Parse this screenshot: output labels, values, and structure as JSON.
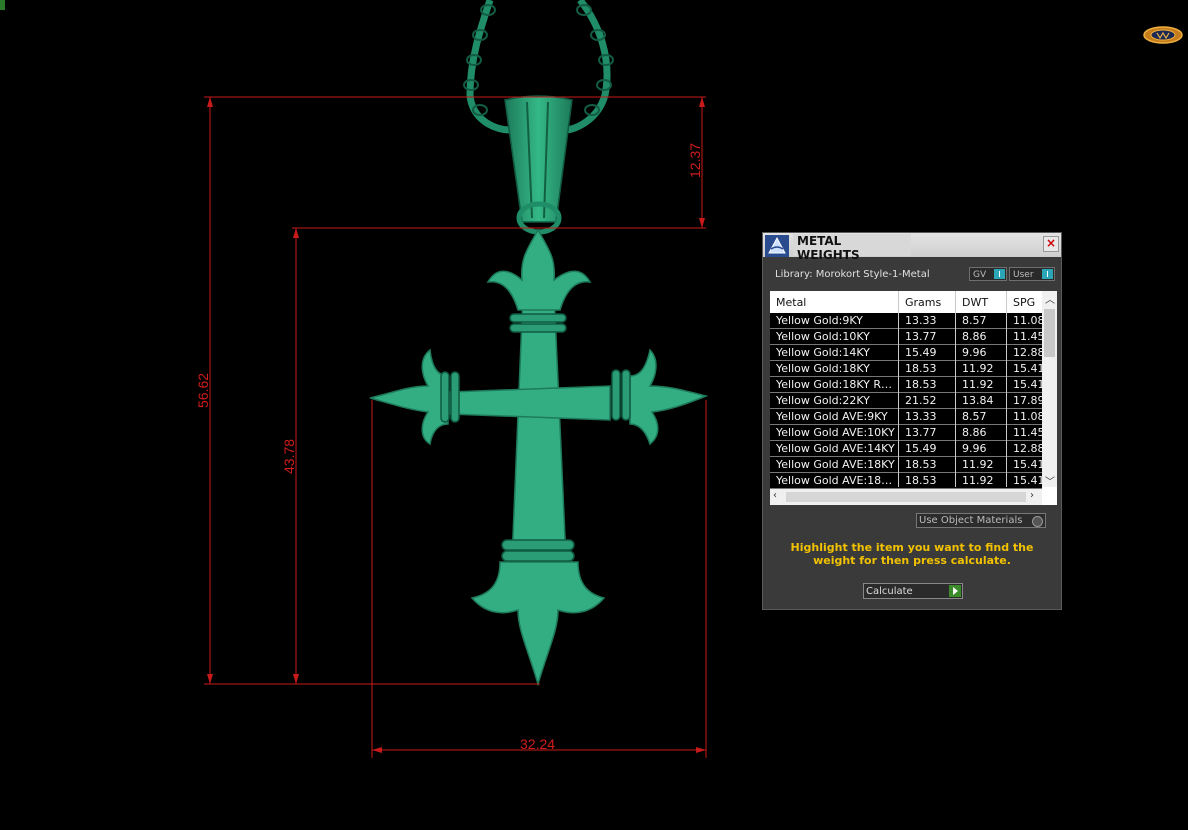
{
  "dimensions": {
    "total_height": "56.62",
    "body_height": "43.78",
    "bail_height": "12.37",
    "width": "32.24"
  },
  "panel": {
    "title": "METAL WEIGHTS",
    "close_label": "×",
    "library": "Library: Morokort Style-1-Metal",
    "toggle_gv": "GV",
    "toggle_user": "User",
    "columns": [
      "Metal",
      "Grams",
      "DWT",
      "SPG"
    ],
    "rows": [
      {
        "metal": "Yellow Gold:9KY",
        "grams": "13.33",
        "dwt": "8.57",
        "spg": "11.08"
      },
      {
        "metal": "Yellow Gold:10KY",
        "grams": "13.77",
        "dwt": "8.86",
        "spg": "11.45"
      },
      {
        "metal": "Yellow Gold:14KY",
        "grams": "15.49",
        "dwt": "9.96",
        "spg": "12.88"
      },
      {
        "metal": "Yellow Gold:18KY",
        "grams": "18.53",
        "dwt": "11.92",
        "spg": "15.41"
      },
      {
        "metal": "Yellow Gold:18KY R…",
        "grams": "18.53",
        "dwt": "11.92",
        "spg": "15.41"
      },
      {
        "metal": "Yellow Gold:22KY",
        "grams": "21.52",
        "dwt": "13.84",
        "spg": "17.89"
      },
      {
        "metal": "Yellow Gold AVE:9KY",
        "grams": "13.33",
        "dwt": "8.57",
        "spg": "11.08"
      },
      {
        "metal": "Yellow Gold AVE:10KY",
        "grams": "13.77",
        "dwt": "8.86",
        "spg": "11.45"
      },
      {
        "metal": "Yellow Gold AVE:14KY",
        "grams": "15.49",
        "dwt": "9.96",
        "spg": "12.88"
      },
      {
        "metal": "Yellow Gold AVE:18KY",
        "grams": "18.53",
        "dwt": "11.92",
        "spg": "15.41"
      },
      {
        "metal": "Yellow Gold AVE:18…",
        "grams": "18.53",
        "dwt": "11.92",
        "spg": "15.41"
      }
    ],
    "use_object_materials": "Use Object Materials",
    "hint": "Highlight the item you want to find the weight for then press calculate.",
    "calculate_label": "Calculate"
  },
  "icons": {
    "panel_icon": "rhino-icon",
    "corner_logo": "matrix-logo-icon"
  },
  "colors": {
    "model": "#2fa57e",
    "dimension": "#d11c1c",
    "hint": "#f2c200"
  }
}
